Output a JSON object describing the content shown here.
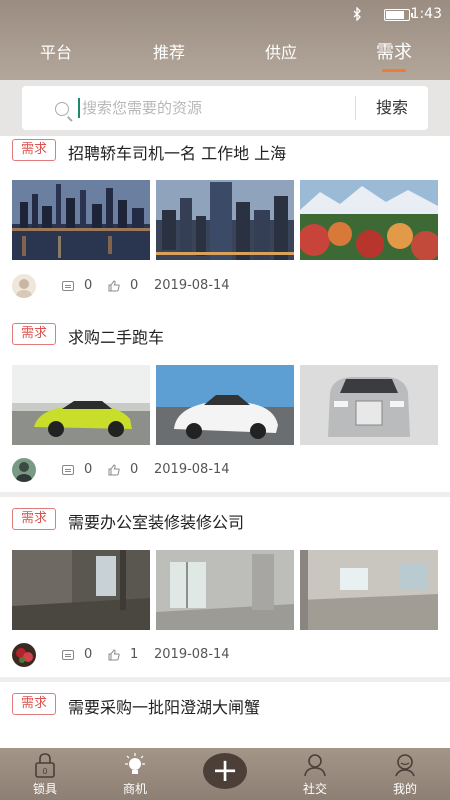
{
  "status": {
    "time": "1:43"
  },
  "tabs": [
    {
      "label": "平台"
    },
    {
      "label": "推荐"
    },
    {
      "label": "供应"
    },
    {
      "label": "需求"
    }
  ],
  "search": {
    "placeholder": "搜索您需要的资源",
    "button_label": "搜索"
  },
  "posts": [
    {
      "tag": "需求",
      "title": "招聘轿车司机一名 工作地 上海",
      "comments": "0",
      "likes": "0",
      "date": "2019-08-14"
    },
    {
      "tag": "需求",
      "title": "求购二手跑车",
      "comments": "0",
      "likes": "0",
      "date": "2019-08-14"
    },
    {
      "tag": "需求",
      "title": "需要办公室装修装修公司",
      "comments": "0",
      "likes": "1",
      "date": "2019-08-14"
    },
    {
      "tag": "需求",
      "title": "需要采购一批阳澄湖大闸蟹"
    }
  ],
  "bottom_nav": [
    {
      "label": "锁具",
      "icon": "lock-icon",
      "badge": "0"
    },
    {
      "label": "商机",
      "icon": "lightbulb-icon"
    },
    {
      "label": "",
      "icon": "plus-icon"
    },
    {
      "label": "社交",
      "icon": "social-icon"
    },
    {
      "label": "我的",
      "icon": "profile-icon"
    }
  ],
  "colors": {
    "header": "#a89b8f",
    "accent": "#ee7b36",
    "tag": "#d9534f",
    "cursor": "#1d8a6e"
  }
}
